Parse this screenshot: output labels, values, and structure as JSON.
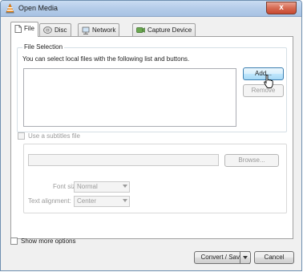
{
  "window": {
    "title": "Open Media",
    "close_glyph": "x"
  },
  "tabs": [
    {
      "label": "File",
      "icon": "file-icon",
      "active": true
    },
    {
      "label": "Disc",
      "icon": "disc-icon",
      "active": false
    },
    {
      "label": "Network",
      "icon": "network-icon",
      "active": false
    },
    {
      "label": "Capture Device",
      "icon": "capture-device-icon",
      "active": false
    }
  ],
  "file_selection": {
    "title": "File Selection",
    "description": "You can select local files with the following list and buttons.",
    "add_label": "Add...",
    "remove_label": "Remove"
  },
  "subtitles": {
    "checkbox_label": "Use a subtitles file",
    "browse_label": "Browse...",
    "font_size_label": "Font size:",
    "font_size_value": "Normal",
    "text_alignment_label": "Text alignment:",
    "text_alignment_value": "Center"
  },
  "footer": {
    "show_more_label": "Show more options",
    "convert_label": "Convert / Save",
    "cancel_label": "Cancel"
  },
  "colors": {
    "titlebar": "#b3cbe8",
    "close_button": "#d66a52",
    "hover_button": "#bee6fd"
  }
}
